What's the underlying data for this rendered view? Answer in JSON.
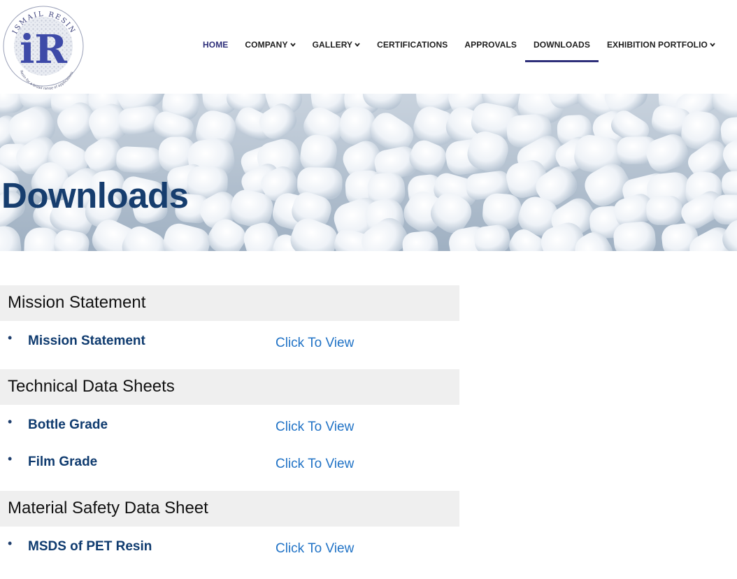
{
  "logo": {
    "arc_text": "ISMAIL RESIN",
    "monogram": "iR",
    "tagline": "Resin for a broad range of applications"
  },
  "nav": {
    "items": [
      {
        "label": "HOME",
        "has_dropdown": false
      },
      {
        "label": "COMPANY",
        "has_dropdown": true
      },
      {
        "label": "GALLERY",
        "has_dropdown": true
      },
      {
        "label": "CERTIFICATIONS",
        "has_dropdown": false
      },
      {
        "label": "APPROVALS",
        "has_dropdown": false
      },
      {
        "label": "DOWNLOADS",
        "has_dropdown": false,
        "active": true
      },
      {
        "label": "EXHIBITION PORTFOLIO",
        "has_dropdown": true
      }
    ],
    "dropdown_glyph": "❯"
  },
  "hero": {
    "title": "Downloads"
  },
  "sections": [
    {
      "heading": "Mission Statement",
      "items": [
        {
          "name": "Mission Statement",
          "link": "Click To View"
        }
      ]
    },
    {
      "heading": "Technical Data Sheets",
      "items": [
        {
          "name": "Bottle Grade",
          "link": "Click To View"
        },
        {
          "name": "Film Grade",
          "link": "Click To View"
        }
      ]
    },
    {
      "heading": "Material Safety Data Sheet",
      "items": [
        {
          "name": "MSDS of PET Resin",
          "link": "Click To View"
        }
      ]
    }
  ],
  "colors": {
    "brand_navy": "#2e2f7a",
    "title_blue": "#163d6e",
    "link_blue": "#2173c6",
    "section_bg": "#efefef"
  },
  "icons": {
    "dropdown": "chevron-down-icon",
    "bullet": "bullet-icon"
  }
}
